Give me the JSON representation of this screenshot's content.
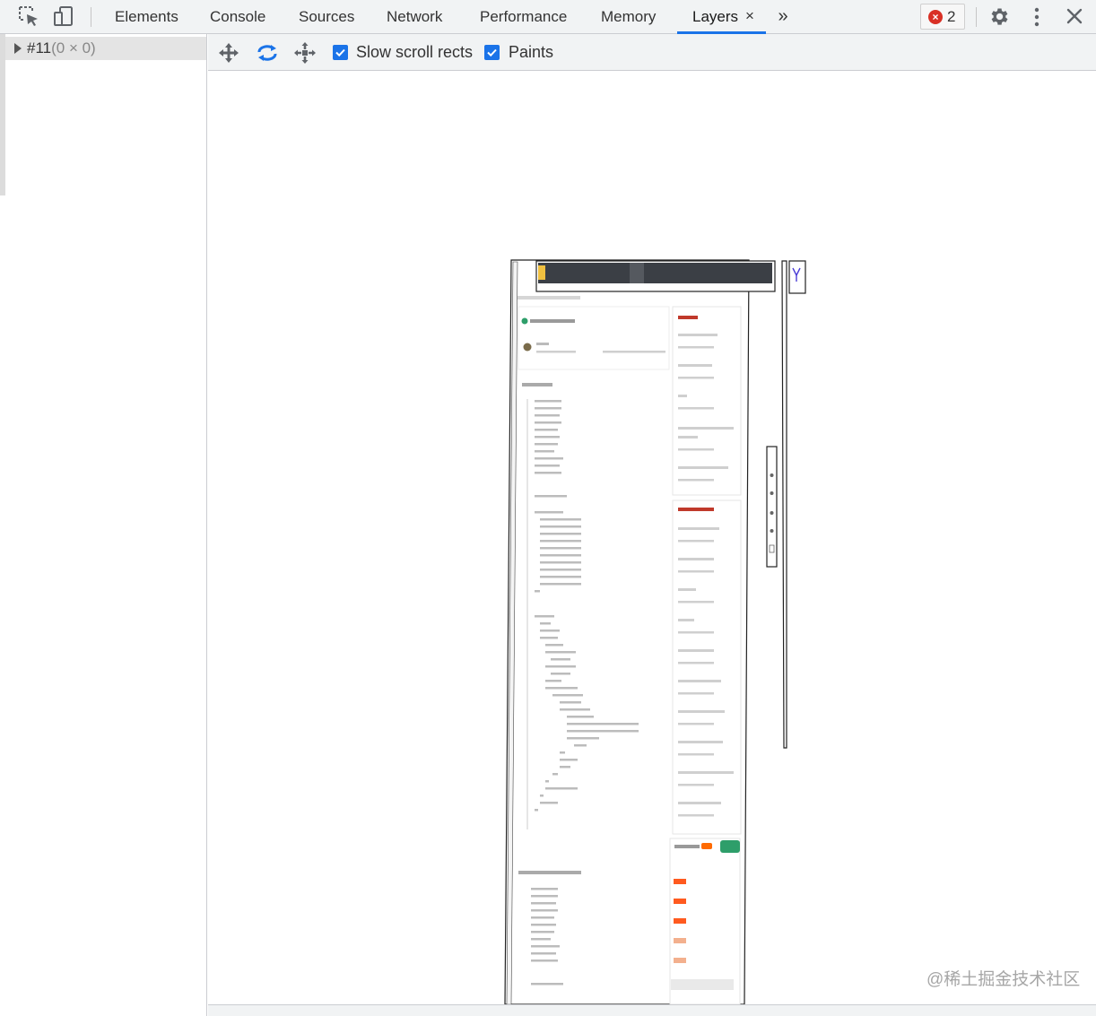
{
  "toolbar": {
    "tabs": [
      "Elements",
      "Console",
      "Sources",
      "Network",
      "Performance",
      "Memory",
      "Layers"
    ],
    "close_glyph": "×",
    "more_glyph": "»",
    "error_count": "2"
  },
  "layer_tree": {
    "root_name": "#11",
    "root_size": "(0 × 0)"
  },
  "layers_toolbar": {
    "slow_scroll_label": "Slow scroll rects",
    "paints_label": "Paints",
    "slow_scroll_checked": true,
    "paints_checked": true
  },
  "watermark": "@稀土掘金技术社区",
  "icons": {
    "inspect": "inspect-element-icon",
    "device": "device-toolbar-icon",
    "pan": "pan-mode-icon",
    "rotate": "rotate-mode-icon",
    "reset": "reset-transform-icon",
    "settings": "gear-icon",
    "menu": "kebab-menu-icon",
    "close": "close-icon"
  },
  "colors": {
    "accent": "#1a73e8",
    "error": "#d93025"
  }
}
